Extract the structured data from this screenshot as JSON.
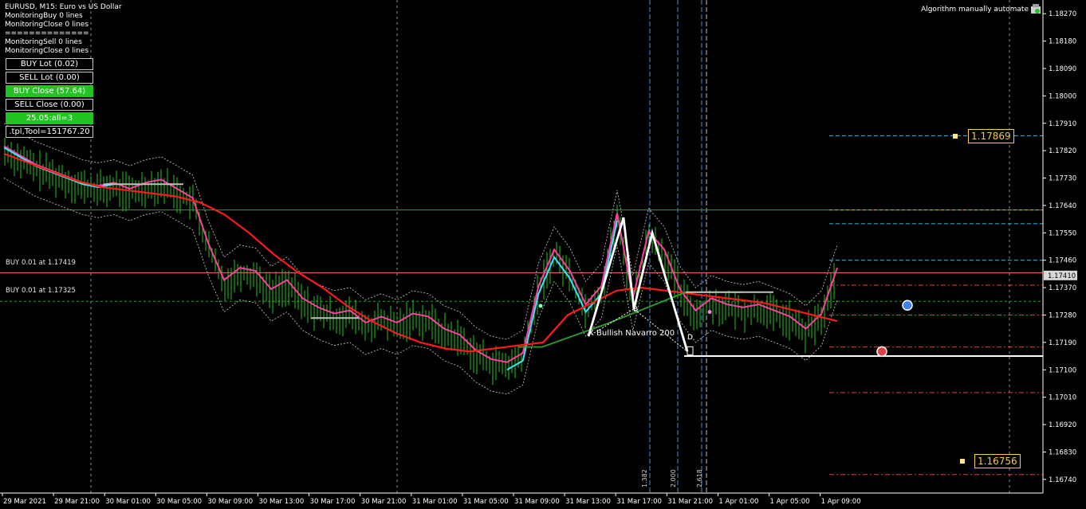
{
  "header": {
    "title": "EURUSD, M15:  Euro vs US Dollar",
    "lines": [
      "MonitoringBuy 0 lines",
      "MonitoringClose 0 lines",
      "==============",
      "MonitoringSell 0 lines",
      "MonitoringClose 0 lines"
    ]
  },
  "panel": {
    "buttons": [
      {
        "label": "BUY Lot (0.02)",
        "style": "dark"
      },
      {
        "label": "SELL Lot (0.00)",
        "style": "dark"
      },
      {
        "label": "BUY Close (57.64)",
        "style": "green"
      },
      {
        "label": "SELL Close (0.00)",
        "style": "dark"
      },
      {
        "label": "25.05:all=3",
        "style": "green"
      },
      {
        "label": ".tpl,Tool=151767.20",
        "style": "dark"
      }
    ]
  },
  "algo": {
    "label": "Algorithm manually automate"
  },
  "positions": [
    {
      "label": "BUY 0.01 at 1.17419",
      "price": 1.17419
    },
    {
      "label": "BUY 0.01 at 1.17325",
      "price": 1.17325
    }
  ],
  "pattern": {
    "label": "X Bullish Navarro 200",
    "points": [
      "B",
      "D"
    ],
    "fib": [
      "1.382",
      "2.000",
      "2.618"
    ]
  },
  "targets": [
    {
      "label": "1.17869",
      "price": 1.17869
    },
    {
      "label": "1.16756",
      "price": 1.16756
    }
  ],
  "colors": {
    "candle": "#22c322",
    "ma_red": "#ff1a1a",
    "ma_cyan": "#40e0ff",
    "ma_pink": "#ff3fa0",
    "ma_green": "#2e9e2e",
    "ma_grey": "#c0c0c0",
    "fib_blue": "#4a90d9",
    "gold": "#f7c94c"
  },
  "chart_data": {
    "type": "line",
    "symbol": "EURUSD",
    "timeframe": "M15",
    "ylim": [
      1.16695,
      1.18315
    ],
    "current_price": "1.17410",
    "y_ticks": [
      "1.18270",
      "1.18180",
      "1.18090",
      "1.18000",
      "1.17910",
      "1.17820",
      "1.17730",
      "1.17640",
      "1.17550",
      "1.17460",
      "1.17370",
      "1.17280",
      "1.17190",
      "1.17100",
      "1.17010",
      "1.16920",
      "1.16830",
      "1.16740"
    ],
    "x_ticks": [
      "29 Mar 2021",
      "29 Mar 21:00",
      "30 Mar 01:00",
      "30 Mar 05:00",
      "30 Mar 09:00",
      "30 Mar 13:00",
      "30 Mar 17:00",
      "30 Mar 21:00",
      "31 Mar 01:00",
      "31 Mar 05:00",
      "31 Mar 09:00",
      "31 Mar 13:00",
      "31 Mar 17:00",
      "31 Mar 21:00",
      "1 Apr 01:00",
      "1 Apr 05:00",
      "1 Apr 09:00"
    ],
    "price_series": [
      1.1782,
      1.1779,
      1.1776,
      1.1774,
      1.1772,
      1.177,
      1.1769,
      1.177,
      1.1768,
      1.177,
      1.1771,
      1.1768,
      1.1765,
      1.175,
      1.1738,
      1.1742,
      1.1741,
      1.1735,
      1.1738,
      1.1732,
      1.1729,
      1.1727,
      1.1728,
      1.1724,
      1.1726,
      1.1724,
      1.1727,
      1.1726,
      1.1722,
      1.172,
      1.1715,
      1.1712,
      1.1711,
      1.1714,
      1.1736,
      1.1748,
      1.1741,
      1.173,
      1.1736,
      1.176,
      1.1732,
      1.1754,
      1.1748,
      1.1735,
      1.1728,
      1.1732,
      1.173,
      1.1729,
      1.173,
      1.1728,
      1.1726,
      1.1722,
      1.1727,
      1.1742
    ],
    "ma_slow": [
      1.1781,
      1.1778,
      1.1775,
      1.1772,
      1.177,
      1.1769,
      1.1768,
      1.1767,
      1.1765,
      1.1761,
      1.1755,
      1.1748,
      1.1742,
      1.1737,
      1.1731,
      1.1726,
      1.1722,
      1.1719,
      1.1717,
      1.1716,
      1.1717,
      1.1718,
      1.1719,
      1.1728,
      1.1732,
      1.1736,
      1.1737,
      1.1736,
      1.1735,
      1.1734,
      1.1733,
      1.1732,
      1.173,
      1.1728,
      1.1726
    ],
    "swing_pattern": [
      {
        "x": "31 Mar 13:00",
        "y": 1.1721
      },
      {
        "x": "31 Mar 15:00",
        "y": 1.176
      },
      {
        "x": "31 Mar 16:00",
        "y": 1.173
      },
      {
        "x": "31 Mar 17:00",
        "y": 1.1755
      },
      {
        "x": "31 Mar 19:00",
        "y": 1.1716
      }
    ],
    "support_level": 1.17145,
    "resistance_level": 1.17625
  }
}
